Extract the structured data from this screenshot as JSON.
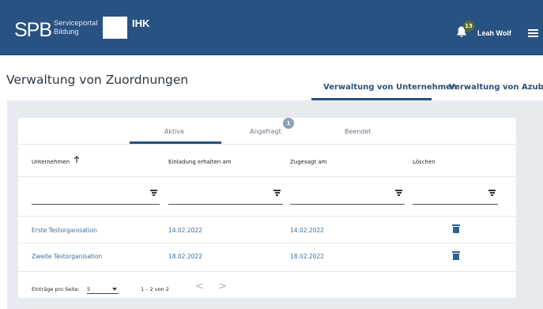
{
  "header": {
    "logo_main": "SPB",
    "logo_sub_line1": "Serviceportal",
    "logo_sub_line2": "Bildung",
    "ihk_label": "IHK",
    "notification_count": "13",
    "user_name": "Leah Wolf",
    "icons": [
      "bell-icon",
      "menu-icon"
    ],
    "brand_color": "#285281"
  },
  "page": {
    "title": "Verwaltung von Zuordnungen",
    "tabs": [
      {
        "label": "Verwaltung von Unternehmen",
        "active": true
      },
      {
        "label": "Verwaltung von Azubis",
        "active": false
      }
    ]
  },
  "subtabs": [
    {
      "label": "Aktive",
      "active": true
    },
    {
      "label": "Angefragt",
      "badge": "1"
    },
    {
      "label": "Beendet"
    }
  ],
  "table": {
    "columns": [
      "Unternehmen",
      "Einladung erhalten am",
      "Zugesagt am",
      "Löschen"
    ],
    "sort_icon": "arrow-up-icon",
    "filter_icon": "filter-icon",
    "rows": [
      {
        "company": "Erste Testorganisation",
        "invited": "14.02.2022",
        "accepted": "14.02.2022"
      },
      {
        "company": "Zweite Testorganisation",
        "invited": "18.02.2022",
        "accepted": "18.02.2022"
      }
    ],
    "row_action_icon": "trash-icon",
    "link_color": "#3a6d9e"
  },
  "pagination": {
    "label": "Einträge pro Seite:",
    "page_size": "5",
    "range": "1 – 2 von 2",
    "prev": "<",
    "next": ">"
  }
}
